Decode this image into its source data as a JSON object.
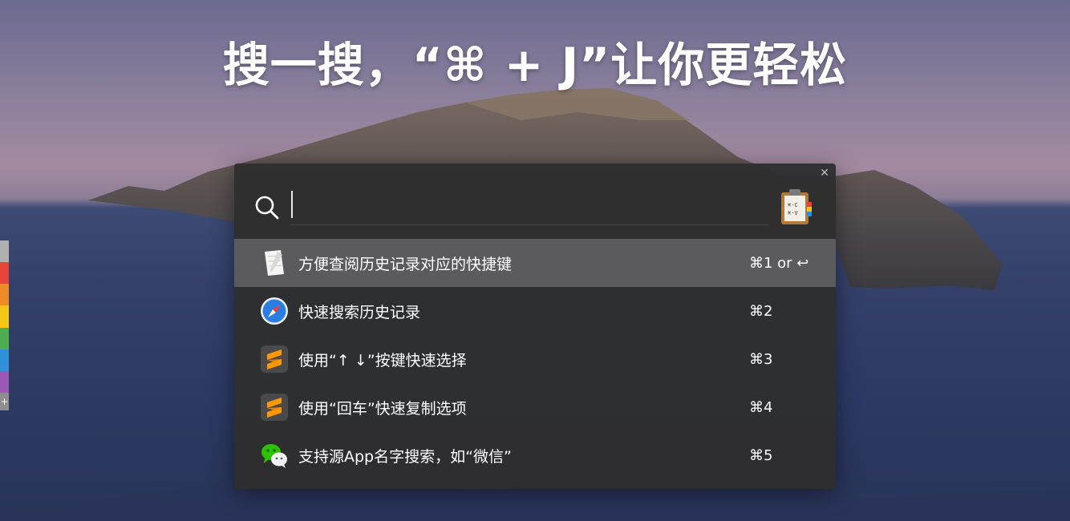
{
  "headline": "搜一搜，“⌘ + J”让你更轻松",
  "search": {
    "value": "",
    "placeholder": ""
  },
  "results": [
    {
      "icon": "notes-icon",
      "label": "方便查阅历史记录对应的快捷键",
      "shortcut": "⌘1 or ↩",
      "selected": true
    },
    {
      "icon": "safari-icon",
      "label": "快速搜索历史记录",
      "shortcut": "⌘2",
      "selected": false
    },
    {
      "icon": "sublime-text-icon",
      "label": "使用“↑ ↓”按键快速选择",
      "shortcut": "⌘3",
      "selected": false
    },
    {
      "icon": "sublime-text-icon",
      "label": "使用“回车”快速复制选项",
      "shortcut": "⌘4",
      "selected": false
    },
    {
      "icon": "wechat-icon",
      "label": "支持源App名字搜索，如“微信”",
      "shortcut": "⌘5",
      "selected": false
    }
  ],
  "colors": {
    "panel_bg": "#2e2e30",
    "selected_row": "#5b5b5d",
    "strip": [
      "#b0b0b0",
      "#e8443a",
      "#f08a24",
      "#f5c518",
      "#4cae4c",
      "#2f8fd8",
      "#9b59b6"
    ]
  },
  "close_icon": "close-icon",
  "strip_plus": "+"
}
